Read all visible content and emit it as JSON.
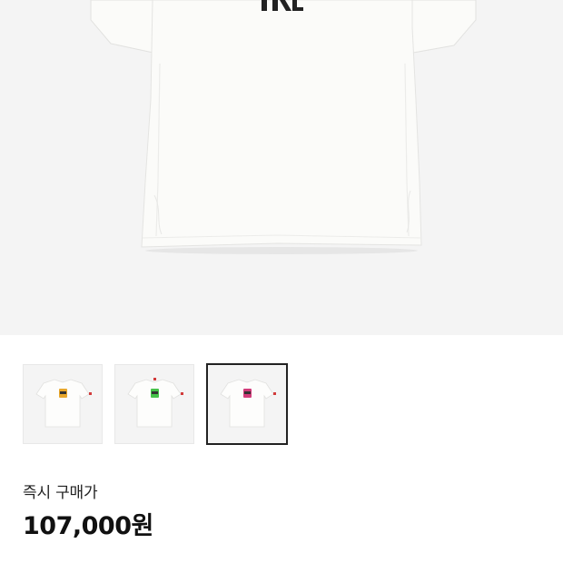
{
  "product": {
    "thumbnails": [
      {
        "accent": "#e8a72c"
      },
      {
        "accent": "#46c24a"
      },
      {
        "accent": "#d23b7a"
      }
    ],
    "selected_index": 2
  },
  "price": {
    "label": "즉시 구매가",
    "value": "107,000원"
  },
  "colors": {
    "hero_background": "#f4f4f4",
    "shirt": "#fbfbf9",
    "selected_border": "#222222"
  }
}
